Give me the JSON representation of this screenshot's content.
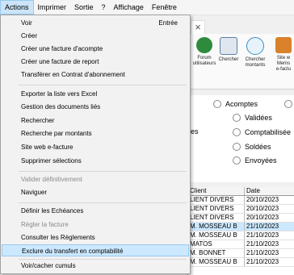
{
  "menubar": {
    "items": [
      "Actions",
      "Imprimer",
      "Sortie",
      "?",
      "Affichage",
      "Fenêtre"
    ]
  },
  "actions_menu": {
    "groups": [
      [
        {
          "label": "Voir",
          "shortcut": "Entrée",
          "enabled": true
        },
        {
          "label": "Créer",
          "enabled": true
        },
        {
          "label": "Créer une facture d'acompte",
          "enabled": true
        },
        {
          "label": "Créer une facture de report",
          "enabled": true
        },
        {
          "label": "Transférer en Contrat d'abonnement",
          "enabled": true
        }
      ],
      [
        {
          "label": "Exporter la liste vers Excel",
          "enabled": true
        },
        {
          "label": "Gestion des documents liés",
          "enabled": true
        },
        {
          "label": "Rechercher",
          "enabled": true
        },
        {
          "label": "Recherche par montants",
          "enabled": true
        },
        {
          "label": "Site web e-facture",
          "enabled": true
        },
        {
          "label": "Supprimer sélections",
          "enabled": true
        }
      ],
      [
        {
          "label": "Valider définitivement",
          "enabled": false
        },
        {
          "label": "Naviguer",
          "enabled": true
        }
      ],
      [
        {
          "label": "Définir les Echéances",
          "enabled": true
        },
        {
          "label": "Régler la facture",
          "enabled": false
        },
        {
          "label": "Consulter les Règlements",
          "enabled": true
        },
        {
          "label": "Exclure du transfert en comptabilité",
          "enabled": true,
          "highlighted": true
        }
      ],
      [
        {
          "label": "Voir/cacher cumuls",
          "enabled": true
        }
      ]
    ]
  },
  "toolbar": {
    "buttons": [
      {
        "label": "Forum\nutilisateurs",
        "icon": "forum-icon",
        "color": "#2e8b3e"
      },
      {
        "label": "Chercher",
        "icon": "search-document-icon",
        "color": "#5b7ea8"
      },
      {
        "label": "Chercher\nmontants",
        "icon": "search-amount-icon",
        "color": "#3a8fc8"
      },
      {
        "label": "Site w\nMems\ne-factu",
        "icon": "website-icon",
        "color": "#d9822b"
      }
    ]
  },
  "filters": {
    "radios": [
      "Acomptes",
      "Validées",
      "Comptabilisée",
      "Soldées",
      "Envoyées"
    ],
    "partial_label": "es"
  },
  "grid": {
    "columns": [
      "Client",
      "Date"
    ],
    "rows": [
      [
        "LIENT DIVERS",
        "20/10/2023"
      ],
      [
        "LIENT DIVERS",
        "20/10/2023"
      ],
      [
        "LIENT DIVERS",
        "20/10/2023"
      ],
      [
        "M. MOSSEAU B",
        "21/10/2023"
      ],
      [
        "M. MOSSEAU B",
        "21/10/2023"
      ],
      [
        "MATOS",
        "21/10/2023"
      ],
      [
        "M. BONNET",
        "21/10/2023"
      ],
      [
        "M. MOSSEAU B",
        "21/10/2023"
      ]
    ],
    "selected_index": 3
  }
}
